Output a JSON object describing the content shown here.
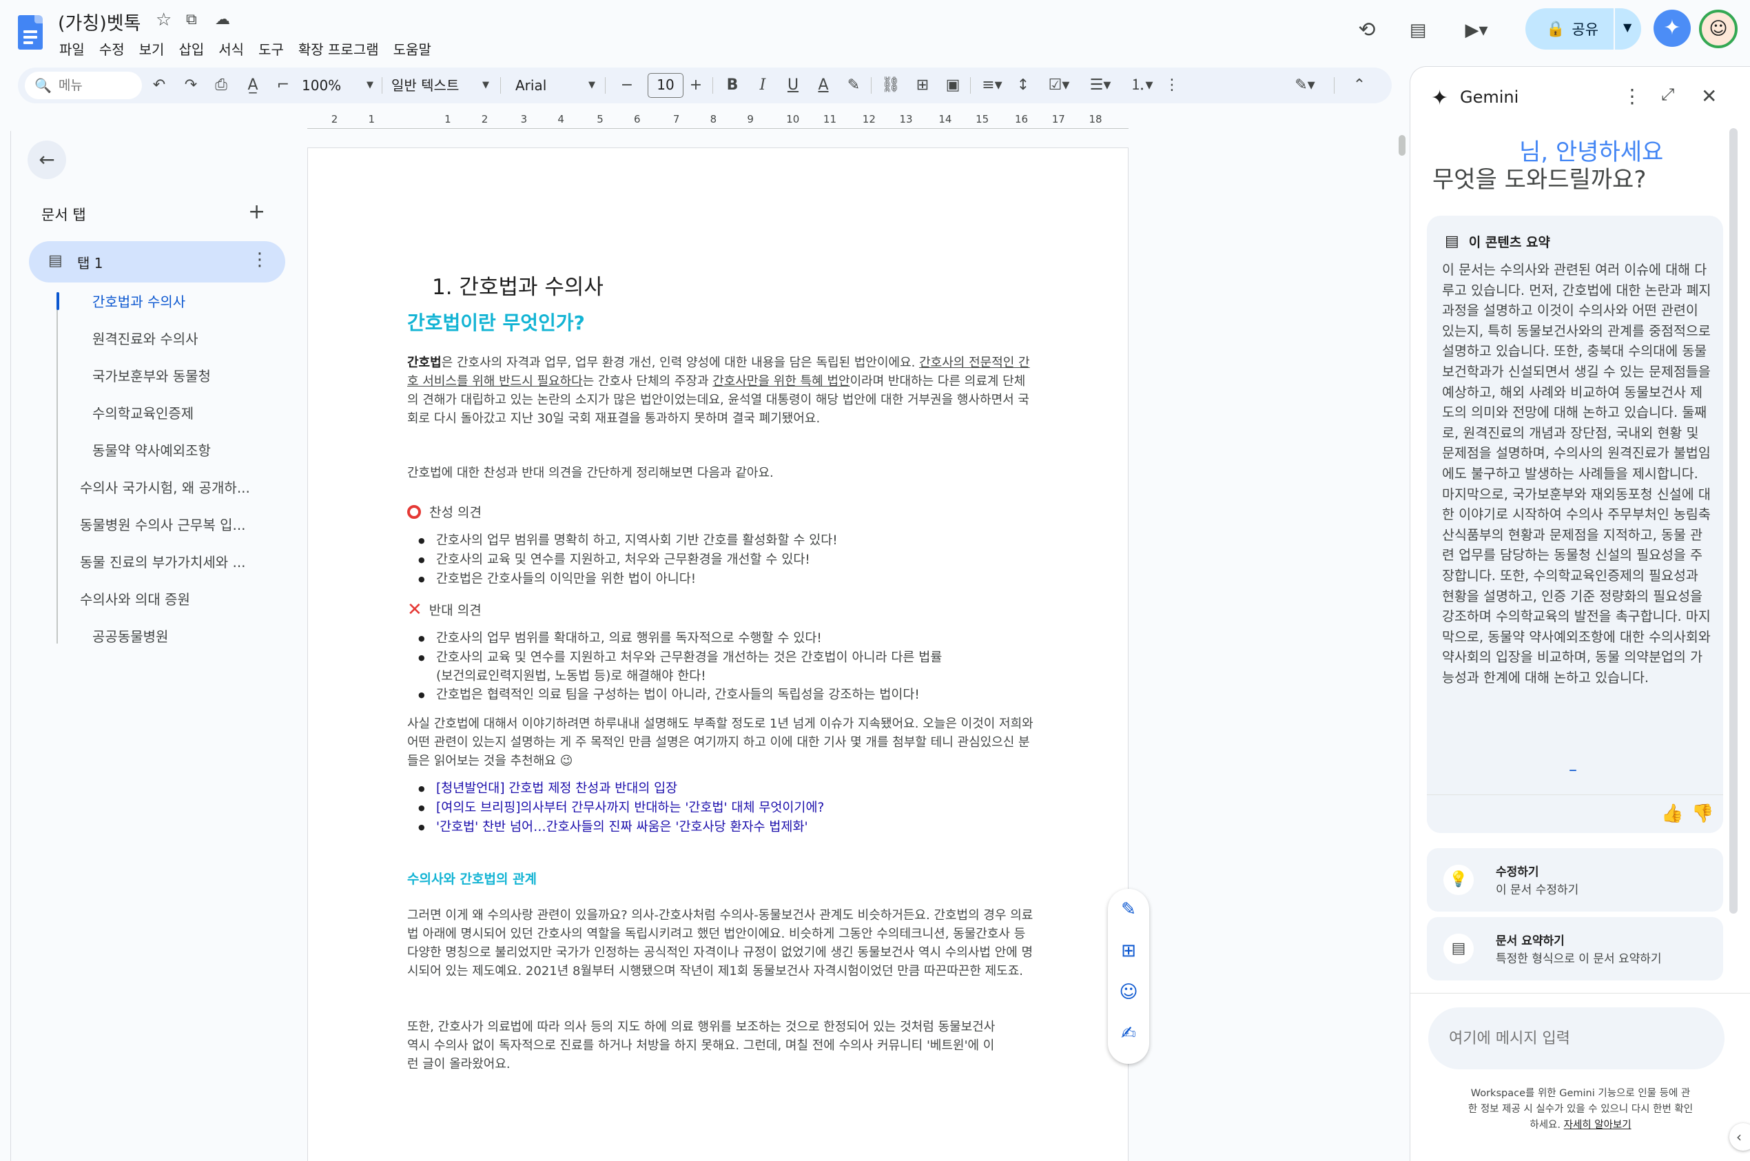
{
  "app": {
    "doc_title": "(가칭)벳톡",
    "menus": [
      "파일",
      "수정",
      "보기",
      "삽입",
      "서식",
      "도구",
      "확장 프로그램",
      "도움말"
    ],
    "share_label": "공유"
  },
  "toolbar": {
    "search_placeholder": "메뉴",
    "zoom": "100%",
    "style": "일반 텍스트",
    "font": "Arial",
    "font_size": "10"
  },
  "ruler": [
    "2",
    "1",
    "1",
    "2",
    "3",
    "4",
    "5",
    "6",
    "7",
    "8",
    "9",
    "10",
    "11",
    "12",
    "13",
    "14",
    "15",
    "16",
    "17",
    "18"
  ],
  "sidebar": {
    "header": "문서 탭",
    "tab_label": "탭 1",
    "outline": [
      "간호법과 수의사",
      "원격진료와 수의사",
      "국가보훈부와 동물청",
      "수의학교육인증제",
      "동물약 약사예외조항",
      "수의사 국가시험, 왜 공개하...",
      "동물병원 수의사 근무복 입...",
      "동물 진료의 부가가치세와 ...",
      "수의사와 의대 증원",
      "공공동물병원"
    ]
  },
  "document": {
    "heading1": "1. 간호법과 수의사",
    "heading2": "간호법이란 무엇인가?",
    "para1": {
      "bold": "간호법",
      "t1": "은 간호사의 자격과 업무, 업무 환경 개선, 인력 양성에 대한 내용을 담은 독립된 법안이에요. ",
      "u1": "간호사의 전문적인 간호 서비스를 위해 반드시 필요하다",
      "t2": "는 간호사 단체의 주장과 ",
      "u2": "간호사만을 위한 특혜 법안",
      "t3": "이라며 반대하는 다른 의료계 단체의 견해가 대립하고 있는 논란의 소지가 많은 법안이었는데요, 윤석열 대통령이 해당 법안에 대한 거부권을 행사하면서 국회로 다시 돌아갔고 지난 30일 국회 재표결을 통과하지 못하며 결국 폐기됐어요."
    },
    "para2": "간호법에 대한 찬성과 반대 의견을 간단하게 정리해보면 다음과 같아요.",
    "pro_head": "찬성 의견",
    "pro": [
      "간호사의 업무 범위를 명확히 하고, 지역사회 기반 간호를 활성화할 수 있다!",
      "간호사의 교육 및 연수를 지원하고, 처우와 근무환경을 개선할 수 있다!",
      "간호법은 간호사들의 이익만을 위한 법이 아니다!"
    ],
    "con_head": "반대 의견",
    "con": [
      "간호사의 업무 범위를 확대하고, 의료 행위를 독자적으로 수행할 수 있다!",
      "간호사의 교육 및 연수를 지원하고 처우와 근무환경을 개선하는 것은 간호법이 아니라 다른 법률(보건의료인력지원법, 노동법 등)로 해결해야 한다!",
      "간호법은 협력적인 의료 팀을 구성하는 법이 아니라, 간호사들의 독립성을 강조하는 법이다!"
    ],
    "para3": "사실 간호법에 대해서 이야기하려면 하루내내 설명해도 부족할 정도로 1년 넘게 이슈가 지속됐어요. 오늘은 이것이 저희와 어떤 관련이 있는지 설명하는 게 주 목적인 만큼 설명은 여기까지 하고 이에 대한 기사 몇 개를 첨부할 테니 관심있으신 분들은 읽어보는 것을 추천해요 😉",
    "links": [
      "[청년발언대] 간호법 제정 찬성과 반대의 입장",
      "[여의도 브리핑]의사부터 간무사까지 반대하는 '간호법' 대체 무엇이기에?",
      "'간호법' 찬반 넘어…간호사들의 진짜 싸움은 '간호사당 환자수 법제화'"
    ],
    "heading3": "수의사와 간호법의 관계",
    "para4": "그러면 이게 왜 수의사랑 관련이 있을까요? 의사-간호사처럼 수의사-동물보건사 관계도 비슷하거든요. 간호법의 경우 의료법 아래에 명시되어 있던 간호사의 역할을 독립시키려고 했던 법안이에요. 비슷하게 그동안 수의테크니션, 동물간호사 등 다양한 명칭으로 불리었지만 국가가 인정하는 공식적인 자격이나 규정이 없었기에 생긴 동물보건사 역시 수의사법 안에 명시되어 있는 제도예요. 2021년 8월부터 시행됐으며 작년이 제1회 동물보건사 자격시험이었던 만큼 따끈따끈한 제도죠.",
    "para5": "또한, 간호사가 의료법에 따라 의사 등의 지도 하에 의료 행위를 보조하는 것으로 한정되어 있는 것처럼 동물보건사 역시 수의사 없이 독자적으로 진료를 하거나 처방을 하지 못해요. 그런데, 며칠 전에 수의사 커뮤니티 '베트윈'에 이런 글이 올라왔어요."
  },
  "gemini": {
    "title": "Gemini",
    "greeting_name": "님, 안녕하세요",
    "greeting_question": "무엇을 도와드릴까요?",
    "summary_header": "이 콘텐츠 요약",
    "summary_body": "이 문서는 수의사와 관련된 여러 이슈에 대해 다루고 있습니다. 먼저, 간호법에 대한 논란과 폐지 과정을 설명하고 이것이 수의사와 어떤 관련이 있는지, 특히 동물보건사와의 관계를 중점적으로 설명하고 있습니다. 또한, 충북대 수의대에 동물보건학과가 신설되면서 생길 수 있는 문제점들을 예상하고, 해외 사례와 비교하여 동물보건사 제도의 의미와 전망에 대해 논하고 있습니다. 둘째로, 원격진료의 개념과 장단점, 국내외 현황 및 문제점을 설명하며, 수의사의 원격진료가 불법임에도 불구하고 발생하는 사례들을 제시합니다. 마지막으로, 국가보훈부와 재외동포청 신설에 대한 이야기로 시작하여 수의사 주무부처인 농림축산식품부의 현황과 문제점을 지적하고, 동물 관련 업무를 담당하는 동물청 신설의 필요성을 주장합니다. 또한, 수의학교육인증제의 필요성과 현황을 설명하고, 인증 기준 정량화의 필요성을 강조하며 수의학교육의 발전을 촉구합니다. 마지막으로, 동물약 약사예외조항에 대한 수의사회와 약사회의 입장을 비교하며, 동물 의약분업의 가능성과 한계에 대해 논하고 있습니다.",
    "summary_dash": "–",
    "suggestions": [
      {
        "title": "수정하기",
        "desc": "이 문서 수정하기"
      },
      {
        "title": "문서 요약하기",
        "desc": "특정한 형식으로 이 문서 요약하기"
      }
    ],
    "input_placeholder": "여기에 메시지 입력",
    "disclaimer": "Workspace를 위한 Gemini 기능으로 인물 등에 관한 정보 제공 시 실수가 있을 수 있으니 다시 한번 확인하세요.",
    "disclaimer_link": "자세히 알아보기"
  },
  "colors": {
    "accent": "#0b57d0",
    "heading_cyan": "#13b4d4",
    "share_bg": "#c2e7ff",
    "tab_active": "#d3e3fd"
  }
}
